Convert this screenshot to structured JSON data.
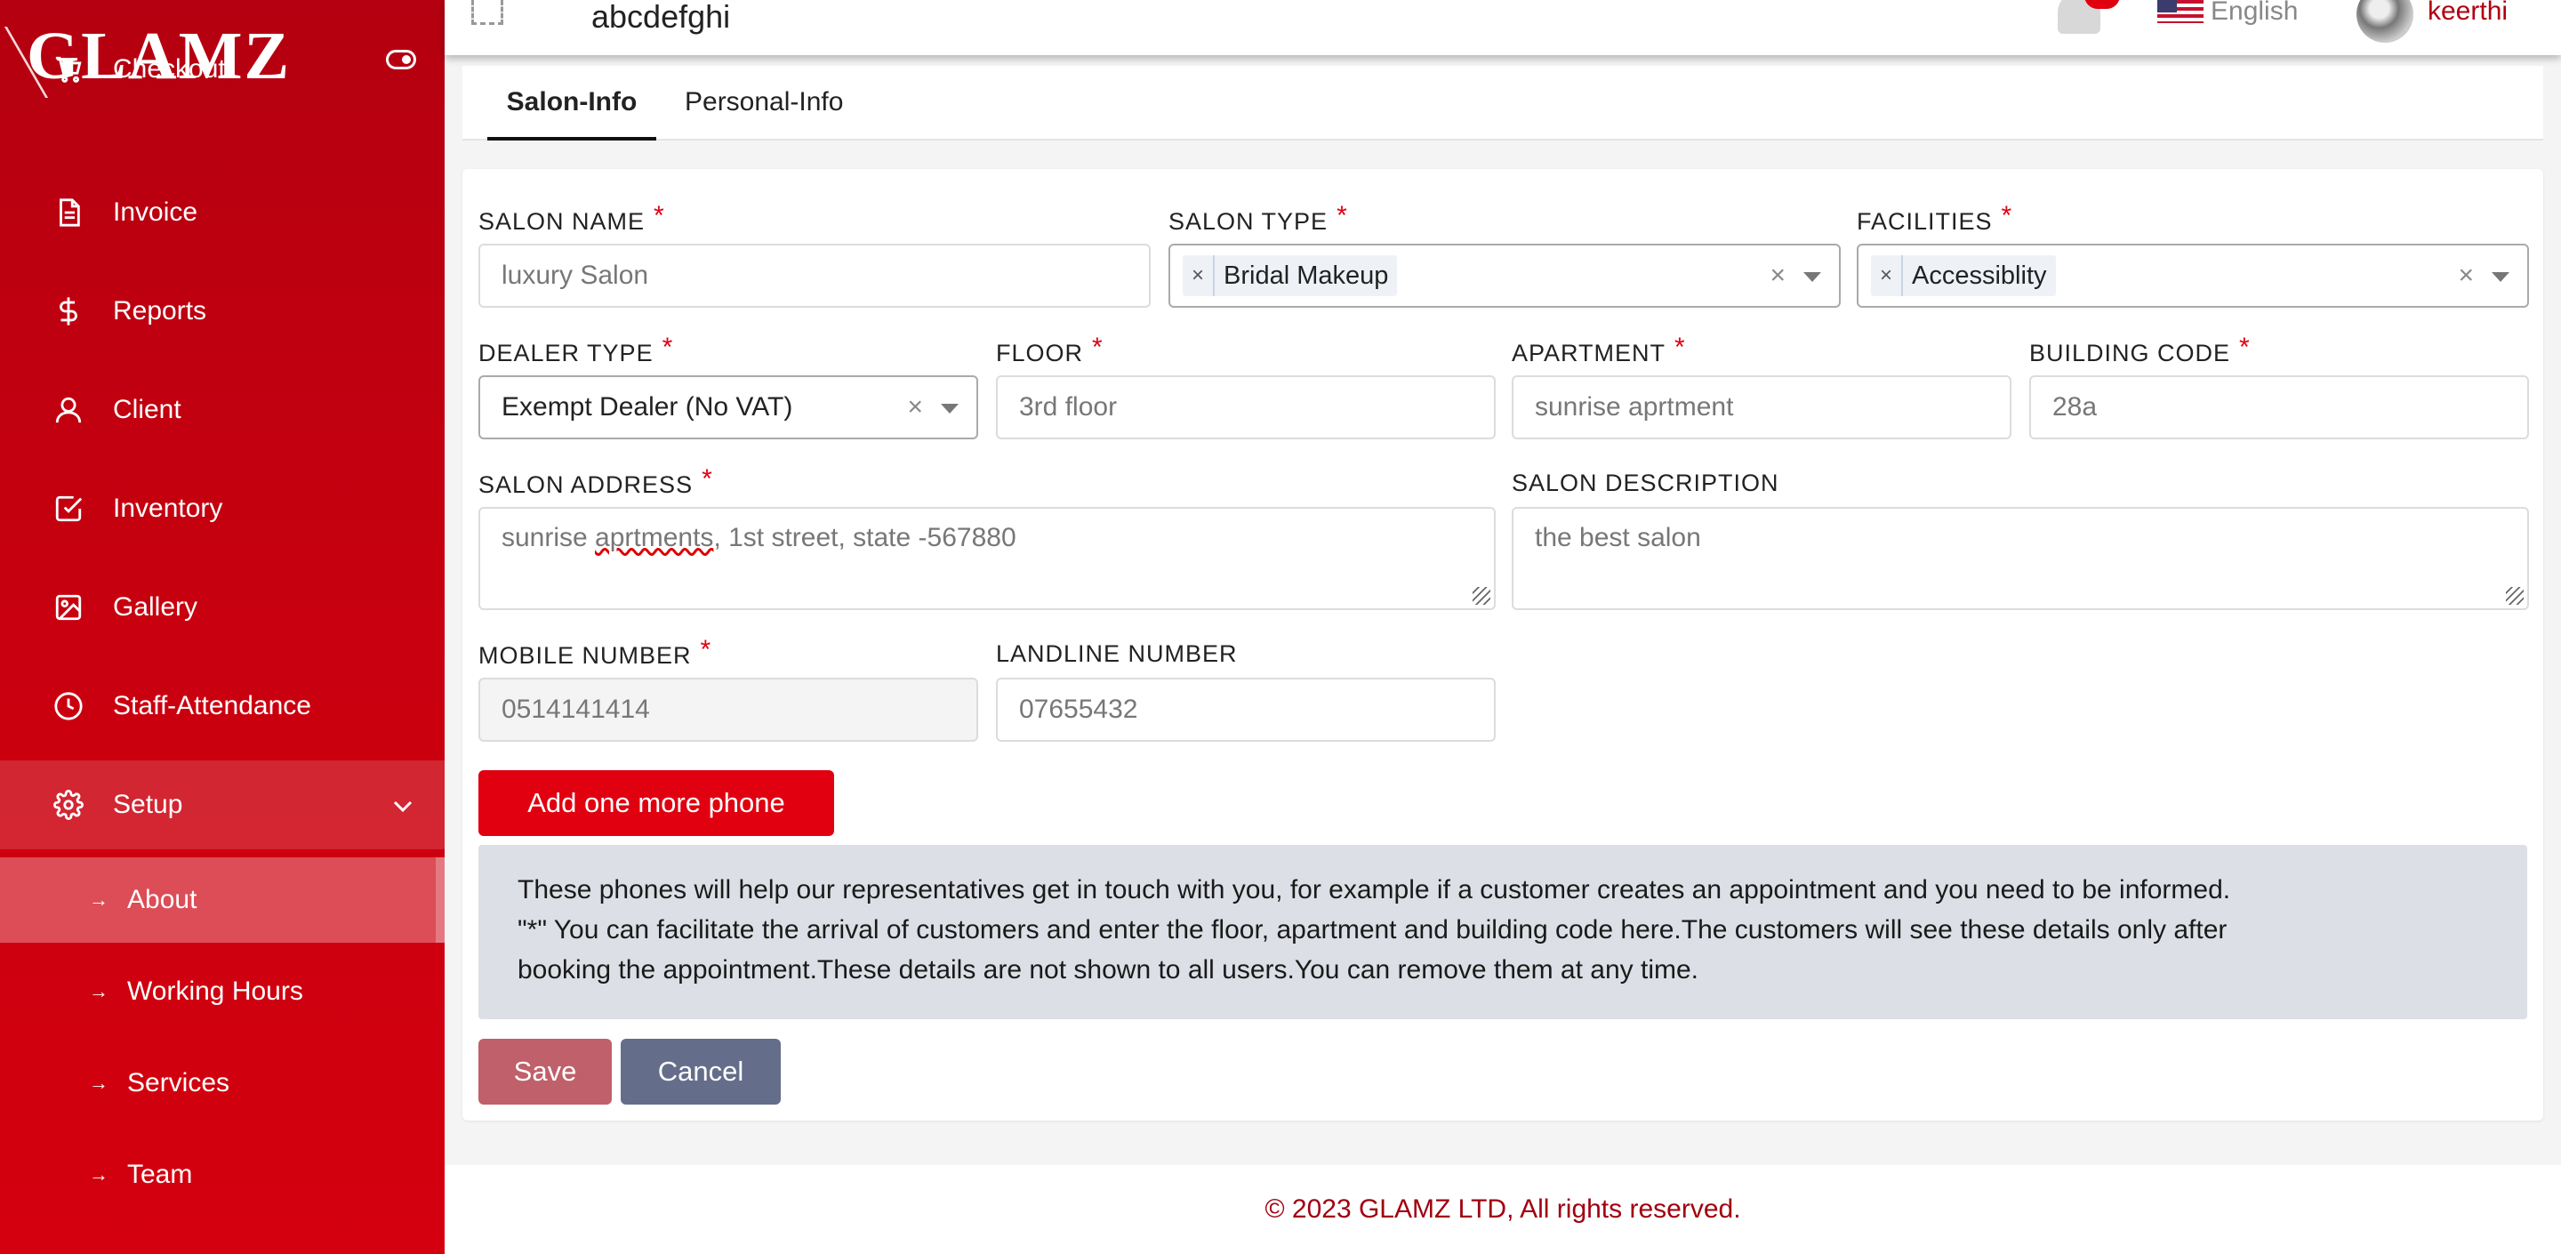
{
  "brand": {
    "logo": "GLAMZ"
  },
  "sidebar": {
    "items": [
      {
        "label": "Checkout",
        "icon": "cart-icon"
      },
      {
        "label": "Invoice",
        "icon": "document-icon"
      },
      {
        "label": "Reports",
        "icon": "dollar-icon"
      },
      {
        "label": "Client",
        "icon": "user-icon"
      },
      {
        "label": "Inventory",
        "icon": "checkbox-icon"
      },
      {
        "label": "Gallery",
        "icon": "image-icon"
      },
      {
        "label": "Staff-Attendance",
        "icon": "clock-icon"
      },
      {
        "label": "Setup",
        "icon": "gear-icon",
        "expanded": true
      }
    ],
    "subitems": [
      {
        "label": "About",
        "active": true
      },
      {
        "label": "Working Hours"
      },
      {
        "label": "Services"
      },
      {
        "label": "Team"
      }
    ]
  },
  "header": {
    "title": "abcdefghi",
    "language": "English",
    "user": "keerthi"
  },
  "tabs": [
    {
      "label": "Salon-Info",
      "active": true
    },
    {
      "label": "Personal-Info"
    }
  ],
  "form": {
    "salon_name": {
      "label": "SALON NAME",
      "required": "*",
      "value": "luxury Salon"
    },
    "salon_type": {
      "label": "SALON TYPE",
      "required": "*",
      "chip": "Bridal Makeup",
      "chip_remove": "×",
      "clear": "×"
    },
    "facilities": {
      "label": "FACILITIES",
      "required": "*",
      "chip": "Accessiblity",
      "chip_remove": "×",
      "clear": "×"
    },
    "dealer_type": {
      "label": "DEALER TYPE",
      "required": "*",
      "value": "Exempt Dealer (No VAT)",
      "clear": "×"
    },
    "floor": {
      "label": "FLOOR",
      "required": "*",
      "value": "3rd floor"
    },
    "apartment": {
      "label": "APARTMENT",
      "required": "*",
      "value": "sunrise aprtment"
    },
    "building_code": {
      "label": "BUILDING CODE",
      "required": "*",
      "value": "28a"
    },
    "salon_address": {
      "label": "SALON ADDRESS",
      "required": "*",
      "value_pre": "sunrise ",
      "value_misspelled": "aprtments",
      "value_post": ", 1st street, state -567880"
    },
    "salon_description": {
      "label": "SALON DESCRIPTION",
      "value": "the best salon"
    },
    "mobile_number": {
      "label": "MOBILE NUMBER",
      "required": "*",
      "value": "0514141414"
    },
    "landline_number": {
      "label": "LANDLINE NUMBER",
      "value": "07655432"
    },
    "add_phone_button": "Add one more phone",
    "info_lines": [
      "These phones will help our representatives get in touch with you, for example if a customer creates an appointment and you need to be informed.",
      "\"*\" You can facilitate the arrival of customers and enter the floor, apartment and building code here.The customers will see these details only after",
      "booking the appointment.These details are not shown to all users.You can remove them at any time."
    ],
    "save_button": "Save",
    "cancel_button": "Cancel"
  },
  "footer": {
    "text": "© 2023 GLAMZ LTD, All rights reserved."
  },
  "colors": {
    "sidebar": "#c8000f",
    "accent": "#e00010",
    "save": "#c0606a",
    "cancel": "#646e8a"
  }
}
